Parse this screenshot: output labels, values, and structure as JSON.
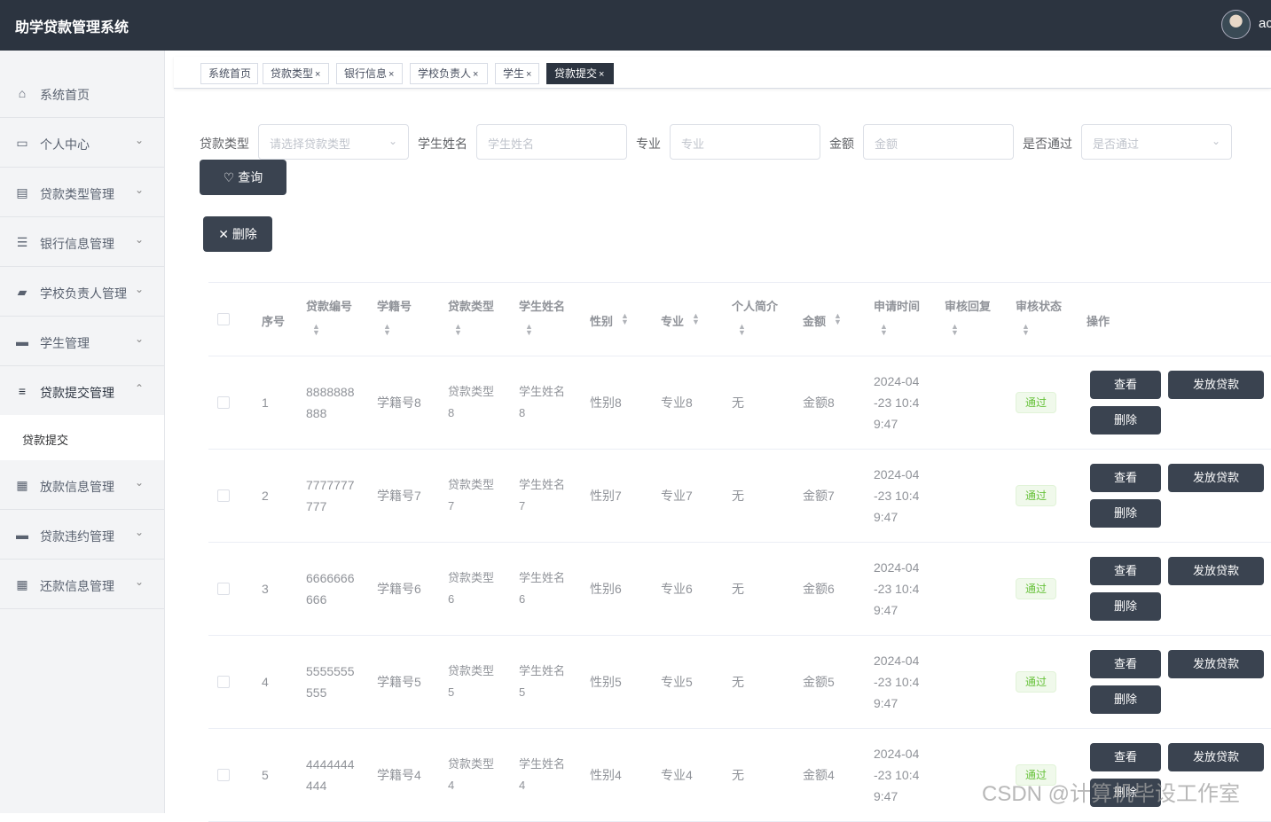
{
  "app": {
    "title": "助学贷款管理系统",
    "user": "ac"
  },
  "sidebar": {
    "items": [
      {
        "label": "系统首页",
        "icon": "home-icon",
        "glyph": "⌂",
        "chevron": ""
      },
      {
        "label": "个人中心",
        "icon": "window-icon",
        "glyph": "▭",
        "chevron": "⌄"
      },
      {
        "label": "贷款类型管理",
        "icon": "clipboard-icon",
        "glyph": "▤",
        "chevron": "⌄"
      },
      {
        "label": "银行信息管理",
        "icon": "list-icon",
        "glyph": "☰",
        "chevron": "⌄"
      },
      {
        "label": "学校负责人管理",
        "icon": "wallet-icon",
        "glyph": "▰",
        "chevron": "⌄"
      },
      {
        "label": "学生管理",
        "icon": "printer-icon",
        "glyph": "▬",
        "chevron": "⌄"
      },
      {
        "label": "贷款提交管理",
        "icon": "menu-icon",
        "glyph": "≡",
        "chevron": "⌃"
      },
      {
        "label": "放款信息管理",
        "icon": "grid-icon",
        "glyph": "▦",
        "chevron": "⌄"
      },
      {
        "label": "贷款违约管理",
        "icon": "ticket-icon",
        "glyph": "▬",
        "chevron": "⌄"
      },
      {
        "label": "还款信息管理",
        "icon": "grid-icon",
        "glyph": "▦",
        "chevron": "⌄"
      }
    ],
    "submenu": "贷款提交"
  },
  "tabs": [
    {
      "label": "系统首页",
      "close": ""
    },
    {
      "label": "贷款类型",
      "close": "×"
    },
    {
      "label": "银行信息",
      "close": "×"
    },
    {
      "label": "学校负责人",
      "close": "×"
    },
    {
      "label": "学生",
      "close": "×"
    },
    {
      "label": "贷款提交",
      "close": "×"
    }
  ],
  "filters": {
    "loan_type": {
      "label": "贷款类型",
      "placeholder": "请选择贷款类型"
    },
    "student_name": {
      "label": "学生姓名",
      "placeholder": "学生姓名"
    },
    "major": {
      "label": "专业",
      "placeholder": "专业"
    },
    "amount": {
      "label": "金额",
      "placeholder": "金额"
    },
    "passed": {
      "label": "是否通过",
      "placeholder": "是否通过"
    }
  },
  "buttons": {
    "query": "查询",
    "delete": "删除"
  },
  "table": {
    "headers": {
      "index": "序号",
      "loan_no": "贷款编号",
      "student_no": "学籍号",
      "loan_type": "贷款类型",
      "student_name": "学生姓名",
      "gender": "性别",
      "major": "专业",
      "intro": "个人简介",
      "amount": "金额",
      "apply_time": "申请时间",
      "review_reply": "审核回复",
      "review_status": "审核状态",
      "actions": "操作"
    },
    "rows": [
      {
        "index": "1",
        "loan_no_1": "8888888",
        "loan_no_2": "888",
        "student_no": "学籍号8",
        "loan_type_1": "贷款类型",
        "loan_type_2": "8",
        "name_1": "学生姓名",
        "name_2": "8",
        "gender": "性别8",
        "major": "专业8",
        "intro": "无",
        "amount": "金额8",
        "time_1": "2024-04",
        "time_2": "-23 10:4",
        "time_3": "9:47",
        "status": "通过"
      },
      {
        "index": "2",
        "loan_no_1": "7777777",
        "loan_no_2": "777",
        "student_no": "学籍号7",
        "loan_type_1": "贷款类型",
        "loan_type_2": "7",
        "name_1": "学生姓名",
        "name_2": "7",
        "gender": "性别7",
        "major": "专业7",
        "intro": "无",
        "amount": "金额7",
        "time_1": "2024-04",
        "time_2": "-23 10:4",
        "time_3": "9:47",
        "status": "通过"
      },
      {
        "index": "3",
        "loan_no_1": "6666666",
        "loan_no_2": "666",
        "student_no": "学籍号6",
        "loan_type_1": "贷款类型",
        "loan_type_2": "6",
        "name_1": "学生姓名",
        "name_2": "6",
        "gender": "性别6",
        "major": "专业6",
        "intro": "无",
        "amount": "金额6",
        "time_1": "2024-04",
        "time_2": "-23 10:4",
        "time_3": "9:47",
        "status": "通过"
      },
      {
        "index": "4",
        "loan_no_1": "5555555",
        "loan_no_2": "555",
        "student_no": "学籍号5",
        "loan_type_1": "贷款类型",
        "loan_type_2": "5",
        "name_1": "学生姓名",
        "name_2": "5",
        "gender": "性别5",
        "major": "专业5",
        "intro": "无",
        "amount": "金额5",
        "time_1": "2024-04",
        "time_2": "-23 10:4",
        "time_3": "9:47",
        "status": "通过"
      },
      {
        "index": "5",
        "loan_no_1": "4444444",
        "loan_no_2": "444",
        "student_no": "学籍号4",
        "loan_type_1": "贷款类型",
        "loan_type_2": "4",
        "name_1": "学生姓名",
        "name_2": "4",
        "gender": "性别4",
        "major": "专业4",
        "intro": "无",
        "amount": "金额4",
        "time_1": "2024-04",
        "time_2": "-23 10:4",
        "time_3": "9:47",
        "status": "通过"
      }
    ],
    "row_actions": {
      "view": "查看",
      "disburse": "发放贷款",
      "delete": "删除"
    }
  },
  "watermark": "CSDN @计算机毕设工作室",
  "colors": {
    "header_bg": "#2c3440",
    "button_bg": "#3a4350",
    "success": "#67c23a"
  }
}
